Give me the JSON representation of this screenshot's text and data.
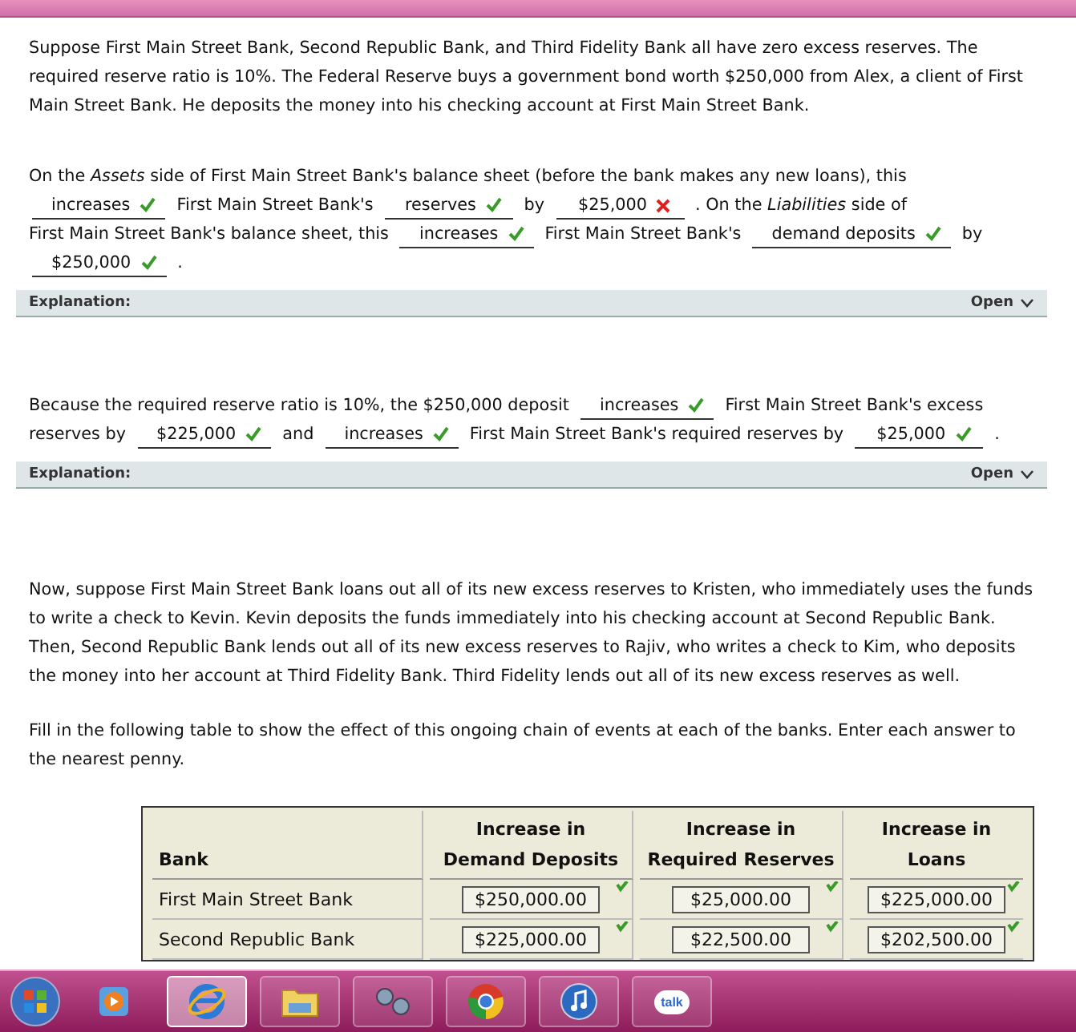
{
  "intro": "Suppose First Main Street Bank, Second Republic Bank, and Third Fidelity Bank all have zero excess reserves. The required reserve ratio is 10%. The Federal Reserve buys a government bond worth $250,000 from Alex, a client of First Main Street Bank. He deposits the money into his checking account at First Main Street Bank.",
  "questions": [
    {
      "lines": [
        [
          {
            "kind": "text",
            "text": "On the *Assets* side of First Main Street Bank's balance sheet (before the bank makes any new loans), this"
          }
        ],
        [
          {
            "kind": "blank",
            "value": "increases",
            "correct": true
          },
          {
            "kind": "text",
            "text": "First Main Street Bank's"
          },
          {
            "kind": "blank",
            "value": "reserves",
            "correct": true
          },
          {
            "kind": "text",
            "text": "by"
          },
          {
            "kind": "blank",
            "value": "$25,000",
            "correct": false
          },
          {
            "kind": "text",
            "text": ". On the *Liabilities* side of"
          }
        ],
        [
          {
            "kind": "text",
            "text": "First Main Street Bank's balance sheet, this"
          },
          {
            "kind": "blank",
            "value": "increases",
            "correct": true
          },
          {
            "kind": "text",
            "text": "First Main Street Bank's"
          },
          {
            "kind": "blank",
            "value": "demand deposits",
            "correct": true
          },
          {
            "kind": "text",
            "text": "by"
          }
        ],
        [
          {
            "kind": "blank",
            "value": "$250,000",
            "correct": true
          },
          {
            "kind": "text",
            "text": "."
          }
        ]
      ],
      "explanation": {
        "label": "Explanation:",
        "toggle": "Open"
      }
    },
    {
      "lines": [
        [
          {
            "kind": "text",
            "text": "Because the required reserve ratio is 10%, the $250,000 deposit"
          },
          {
            "kind": "blank",
            "value": "increases",
            "correct": true
          },
          {
            "kind": "text",
            "text": "First Main Street Bank's excess"
          }
        ],
        [
          {
            "kind": "text",
            "text": "reserves by"
          },
          {
            "kind": "blank",
            "value": "$225,000",
            "correct": true
          },
          {
            "kind": "text",
            "text": "and"
          },
          {
            "kind": "blank",
            "value": "increases",
            "correct": true
          },
          {
            "kind": "text",
            "text": "First Main Street Bank's required reserves by"
          },
          {
            "kind": "blank",
            "value": "$25,000",
            "correct": true
          },
          {
            "kind": "text",
            "text": "."
          }
        ]
      ],
      "explanation": {
        "label": "Explanation:",
        "toggle": "Open"
      }
    }
  ],
  "story": "Now, suppose First Main Street Bank loans out all of its new excess reserves to Kristen, who immediately uses the funds to write a check to Kevin. Kevin deposits the funds immediately into his checking account at Second Republic Bank. Then, Second Republic Bank lends out all of its new excess reserves to Rajiv, who writes a check to Kim, who deposits the money into her account at Third Fidelity Bank. Third Fidelity lends out all of its new excess reserves as well.",
  "instruction": "Fill in the following table to show the effect of this ongoing chain of events at each of the banks. Enter each answer to the nearest penny.",
  "table": {
    "columns": [
      "Bank",
      "Increase in Demand Deposits",
      "Increase in Required Reserves",
      "Increase in Loans"
    ],
    "rows": [
      {
        "cells": [
          {
            "kind": "label",
            "value": "First Main Street Bank"
          },
          {
            "kind": "input",
            "value": "$250,000.00",
            "correct": true
          },
          {
            "kind": "input",
            "value": "$25,000.00",
            "correct": true
          },
          {
            "kind": "input",
            "value": "$225,000.00",
            "correct": true
          }
        ]
      },
      {
        "cells": [
          {
            "kind": "label",
            "value": "Second Republic Bank"
          },
          {
            "kind": "input",
            "value": "$225,000.00",
            "correct": true
          },
          {
            "kind": "input",
            "value": "$22,500.00",
            "correct": true
          },
          {
            "kind": "input",
            "value": "$202,500.00",
            "correct": true
          }
        ]
      }
    ]
  },
  "taskbar": {
    "apps": [
      {
        "kind": "media",
        "selected": false
      },
      {
        "kind": "browser-e",
        "selected": true
      },
      {
        "kind": "folder",
        "selected": false
      },
      {
        "kind": "link",
        "selected": false
      },
      {
        "kind": "chrome",
        "selected": false
      },
      {
        "kind": "music",
        "selected": false
      },
      {
        "kind": "talk",
        "selected": false,
        "label": "talk"
      }
    ]
  }
}
